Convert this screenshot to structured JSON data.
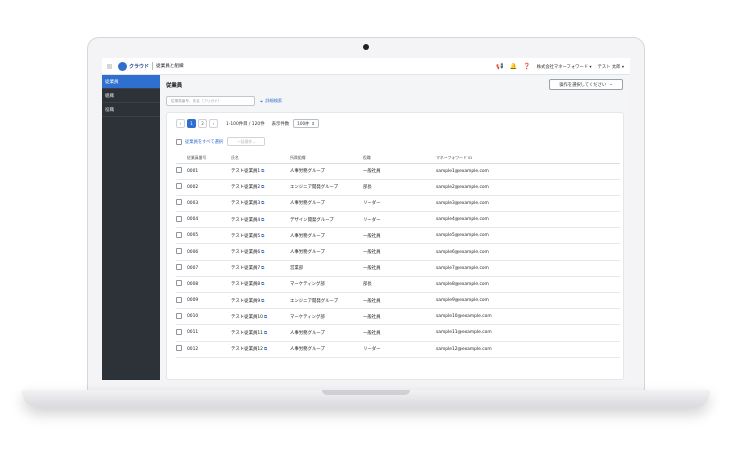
{
  "app": {
    "logo_text": "クラウド",
    "title": "従業員と組織",
    "company": "株式会社マネーフォワード",
    "user": "テスト 太郎"
  },
  "sidebar": {
    "items": [
      {
        "label": "従業員",
        "active": true
      },
      {
        "label": "組織",
        "active": false
      },
      {
        "label": "役職",
        "active": false
      }
    ]
  },
  "main": {
    "title": "従業員",
    "action_button": "操作を選択してください",
    "search_placeholder": "従業員番号、氏名（フリガナ）",
    "advanced_search": "詳細検索"
  },
  "pagination": {
    "pages": [
      "1",
      "2"
    ],
    "current": "1",
    "range_text": "1-100件目 / 120件",
    "per_page_label": "表示件数",
    "per_page_value": "100件"
  },
  "bulk": {
    "select_all": "従業員をすべて選択",
    "bulk_action": "一括操作"
  },
  "table": {
    "headers": [
      "従業員番号",
      "氏名",
      "所属組織",
      "役職",
      "マネーフォワード ID"
    ],
    "rows": [
      [
        "0001",
        "テスト従業員1",
        "人事労務グループ",
        "一般社員",
        "sample1@example.com"
      ],
      [
        "0002",
        "テスト従業員2",
        "エンジニア開発グループ",
        "部長",
        "sample2@example.com"
      ],
      [
        "0003",
        "テスト従業員3",
        "人事労務グループ",
        "リーダー",
        "sample3@example.com"
      ],
      [
        "0004",
        "テスト従業員4",
        "デザイン開発グループ",
        "リーダー",
        "sample4@example.com"
      ],
      [
        "0005",
        "テスト従業員5",
        "人事労務グループ",
        "一般社員",
        "sample5@example.com"
      ],
      [
        "0006",
        "テスト従業員6",
        "人事労務グループ",
        "一般社員",
        "sample6@example.com"
      ],
      [
        "0007",
        "テスト従業員7",
        "営業部",
        "一般社員",
        "sample7@example.com"
      ],
      [
        "0008",
        "テスト従業員8",
        "マーケティング部",
        "部長",
        "sample8@example.com"
      ],
      [
        "0009",
        "テスト従業員9",
        "エンジニア開発グループ",
        "一般社員",
        "sample9@example.com"
      ],
      [
        "0010",
        "テスト従業員10",
        "マーケティング部",
        "一般社員",
        "sample10@example.com"
      ],
      [
        "0011",
        "テスト従業員11",
        "人事労務グループ",
        "一般社員",
        "sample11@example.com"
      ],
      [
        "0012",
        "テスト従業員12",
        "人事労務グループ",
        "リーダー",
        "sample12@example.com"
      ]
    ]
  },
  "colors": {
    "accent": "#2f6fd0",
    "sidebar_bg": "#2d3138"
  }
}
